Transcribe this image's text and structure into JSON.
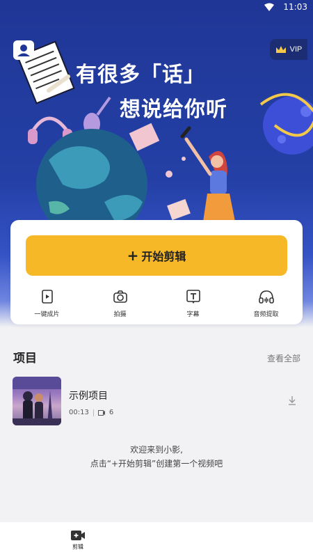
{
  "status_bar": {
    "time": "11:03"
  },
  "header": {
    "vip_label": "VIP",
    "headline_line1": "有很多「话」",
    "headline_line2": "想说给你听"
  },
  "main": {
    "start_button_label": "开始剪辑",
    "tools": [
      {
        "label": "一键成片",
        "icon": "template-doc-icon"
      },
      {
        "label": "拍摄",
        "icon": "camera-icon"
      },
      {
        "label": "字幕",
        "icon": "text-subtitle-icon"
      },
      {
        "label": "音频提取",
        "icon": "headphones-icon"
      }
    ]
  },
  "projects": {
    "title": "项目",
    "view_all": "查看全部",
    "items": [
      {
        "name": "示例项目",
        "duration": "00:13",
        "clip_count": "6"
      }
    ],
    "welcome_line1": "欢迎来到小影,",
    "welcome_line2": "点击“+开始剪辑”创建第一个视频吧"
  },
  "bottom_nav": {
    "items": [
      {
        "label": "剪辑"
      }
    ]
  },
  "colors": {
    "banner_blue": "#2440a6",
    "accent_yellow": "#f7b827"
  }
}
